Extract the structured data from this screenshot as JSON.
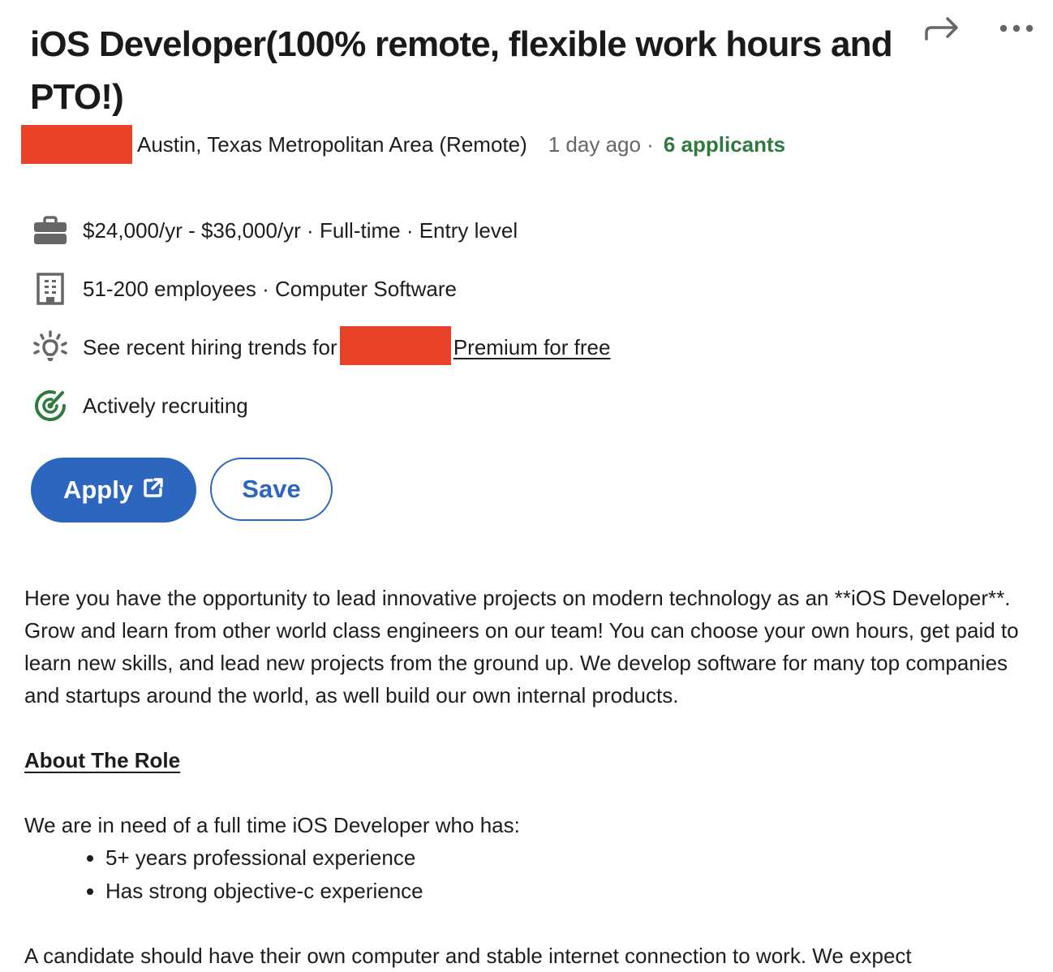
{
  "job": {
    "title": "iOS Developer(100% remote, flexible work hours and PTO!)",
    "location": "Austin, Texas Metropolitan Area (Remote)",
    "posted": "1 day ago ·",
    "applicants": "6 applicants"
  },
  "actions": {
    "share_icon": "share-arrow-icon",
    "more_icon": "more-horizontal-icon"
  },
  "insights": [
    {
      "icon": "briefcase-icon",
      "text": "$24,000/yr - $36,000/yr · Full-time · Entry level"
    },
    {
      "icon": "building-icon",
      "text": "51-200 employees · Computer Software"
    },
    {
      "icon": "lightbulb-icon",
      "text_before": "See recent hiring trends for ",
      "link": "Premium for free"
    },
    {
      "icon": "target-icon",
      "text": "Actively recruiting"
    }
  ],
  "buttons": {
    "apply": "Apply",
    "save": "Save"
  },
  "colors": {
    "primary": "#2d66bf",
    "applicants_green": "#2e7a3e",
    "redaction": "#e84228"
  },
  "description": {
    "intro": "Here you have the opportunity to lead innovative projects on modern technology as an **iOS Developer**. Grow and learn from other world class engineers on our team! You can choose your own hours, get paid to learn new skills, and lead new projects from the ground up. We develop software for many top companies and startups around the world, as well build our own internal products.",
    "section_heading": "About The Role",
    "needs_intro": "We are in need of a full time iOS Developer who has:",
    "requirements": [
      "5+ years professional experience",
      "Has strong objective-c experience"
    ],
    "cut_off_line": "A candidate should have their own computer and stable internet connection to work. We expect"
  }
}
